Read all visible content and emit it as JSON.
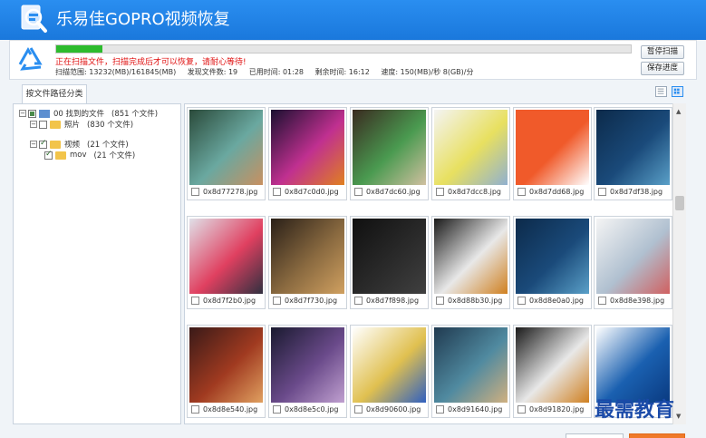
{
  "app": {
    "title": "乐易佳GOPRO视频恢复"
  },
  "progress": {
    "fraction": 0.08,
    "warning": "正在扫描文件，扫描完成后才可以恢复，请耐心等待!",
    "range_label": "扫描范围: 13232(MB)/161845(MB)",
    "files_found_label": "发现文件数: 19",
    "elapsed_label": "已用时间: 01:28",
    "remaining_label": "剩余时间: 16:12",
    "speed_label": "速度: 150(MB)/秒  8(GB)/分"
  },
  "buttons": {
    "pause": "暂停扫描",
    "save": "保存进度"
  },
  "tabs": {
    "by_path": "按文件路径分类"
  },
  "tree": [
    {
      "label": "00 找到的文件",
      "count": "(851 个文件)",
      "level": 0,
      "kind": "pc",
      "check": "partial",
      "expander": "−"
    },
    {
      "label": "照片",
      "count": "(830 个文件)",
      "level": 1,
      "kind": "folder",
      "check": "none",
      "expander": "−"
    },
    {
      "label": "视频",
      "count": "(21 个文件)",
      "level": 1,
      "kind": "folder",
      "check": "checked",
      "expander": "−"
    },
    {
      "label": "mov",
      "count": "(21 个文件)",
      "level": 2,
      "kind": "folder",
      "check": "checked",
      "expander": ""
    }
  ],
  "files": [
    {
      "name": "0x8d77278.jpg",
      "palette": [
        "#2a4a3a",
        "#6aa8a0",
        "#c89060"
      ]
    },
    {
      "name": "0x8d7c0d0.jpg",
      "palette": [
        "#1a1030",
        "#c03090",
        "#e08020"
      ]
    },
    {
      "name": "0x8d7dc60.jpg",
      "palette": [
        "#3a2a20",
        "#4a9a50",
        "#d0c0a0"
      ]
    },
    {
      "name": "0x8d7dcc8.jpg",
      "palette": [
        "#f4f4f4",
        "#e8e060",
        "#90b0d0"
      ]
    },
    {
      "name": "0x8d7dd68.jpg",
      "palette": [
        "#f05a2a",
        "#f05a2a",
        "#ffffff"
      ]
    },
    {
      "name": "0x8d7df38.jpg",
      "palette": [
        "#0c2a4a",
        "#1a4a7a",
        "#5aa0c8"
      ]
    },
    {
      "name": "0x8d7f2b0.jpg",
      "palette": [
        "#e0e0e8",
        "#e04060",
        "#303040"
      ]
    },
    {
      "name": "0x8d7f730.jpg",
      "palette": [
        "#2a2018",
        "#8a6a40",
        "#d0a060"
      ]
    },
    {
      "name": "0x8d7f898.jpg",
      "palette": [
        "#101010",
        "#2a2a2a",
        "#404040"
      ]
    },
    {
      "name": "0x8d88b30.jpg",
      "palette": [
        "#1a1a1a",
        "#e8e8e8",
        "#d08020"
      ]
    },
    {
      "name": "0x8d8e0a0.jpg",
      "palette": [
        "#0c2a4a",
        "#1a4a7a",
        "#5aa0c8"
      ]
    },
    {
      "name": "0x8d8e398.jpg",
      "palette": [
        "#f4f4f4",
        "#b0c0d0",
        "#d06060"
      ]
    },
    {
      "name": "0x8d8e540.jpg",
      "palette": [
        "#3a1a18",
        "#a03a20",
        "#e0a060"
      ]
    },
    {
      "name": "0x8d8e5c0.jpg",
      "palette": [
        "#1a1a30",
        "#6a4a8a",
        "#c0a0d0"
      ]
    },
    {
      "name": "0x8d90600.jpg",
      "palette": [
        "#ffffff",
        "#e0c050",
        "#3060c0"
      ]
    },
    {
      "name": "0x8d91640.jpg",
      "palette": [
        "#203a50",
        "#508aa0",
        "#d0b080"
      ]
    },
    {
      "name": "0x8d91820.jpg",
      "palette": [
        "#1a1a1a",
        "#e8e8e8",
        "#d08020"
      ]
    },
    {
      "name": "",
      "palette": [
        "#ffffff",
        "#1a60b0",
        "#0a3a80"
      ]
    }
  ],
  "watermark": "最需教育",
  "colors": {
    "title_bar": "#1a78dc",
    "progress_fill": "#2dbb2d",
    "warning": "#e01010"
  }
}
